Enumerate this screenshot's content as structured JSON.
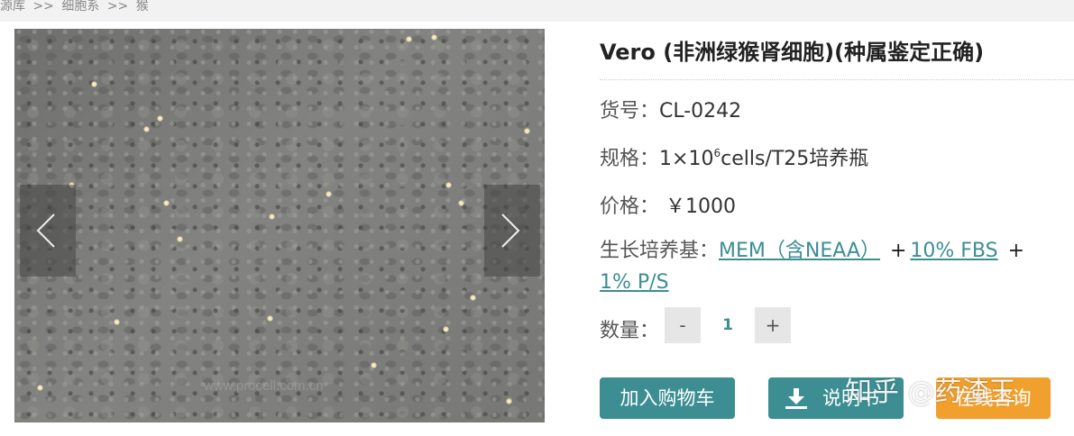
{
  "breadcrumb": {
    "items": [
      "源库",
      "细胞系",
      "猴"
    ],
    "separator": ">>"
  },
  "gallery": {
    "watermark": "www.procell.com.cn",
    "prev_icon": "chevron-left-icon",
    "next_icon": "chevron-right-icon"
  },
  "product": {
    "title": "Vero (非洲绿猴肾细胞)(种属鉴定正确)",
    "sku_label": "货号：",
    "sku_value": "CL-0242",
    "spec_label": "规格：",
    "spec_prefix": "1×10",
    "spec_exponent": "6",
    "spec_suffix": "cells/T25培养瓶",
    "price_label": "价格：",
    "price_value": "￥1000",
    "medium_label": "生长培养基：",
    "medium_link1": "MEM（含NEAA）",
    "medium_plus": "+",
    "medium_link2": "10% FBS",
    "medium_link3": "1% P/S",
    "qty_label": "数量：",
    "qty_minus": "-",
    "qty_value": "1",
    "qty_plus": "+"
  },
  "buttons": {
    "add_to_cart": "加入购物车",
    "manual": "说明书",
    "consult": "在线咨询"
  },
  "overlay_watermark": "知乎 @药渣王",
  "colors": {
    "accent": "#3c8e93",
    "consult": "#f2a02d"
  }
}
